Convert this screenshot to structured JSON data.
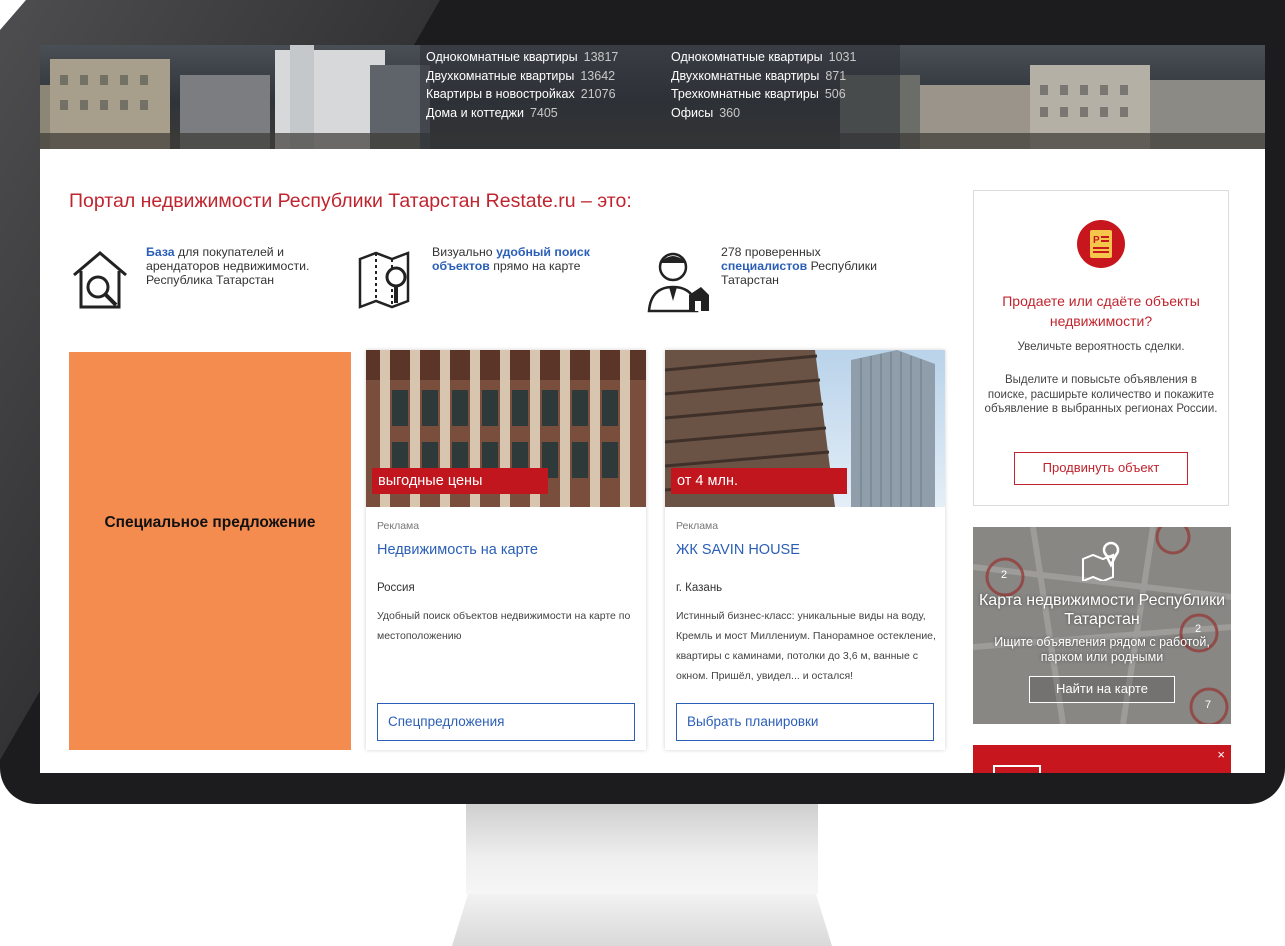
{
  "banner": {
    "stats_left": [
      {
        "label": "Однокомнатные квартиры",
        "count": "13817"
      },
      {
        "label": "Двухкомнатные квартиры",
        "count": "13642"
      },
      {
        "label": "Квартиры в новостройках",
        "count": "21076"
      },
      {
        "label": "Дома и коттеджи",
        "count": "7405"
      }
    ],
    "stats_right": [
      {
        "label": "Однокомнатные квартиры",
        "count": "1031"
      },
      {
        "label": "Двухкомнатные квартиры",
        "count": "871"
      },
      {
        "label": "Трехкомнатные квартиры",
        "count": "506"
      },
      {
        "label": "Офисы",
        "count": "360"
      }
    ]
  },
  "intro": {
    "title": "Портал недвижимости Республики Татарстан Restate.ru – это:",
    "features": [
      {
        "icon": "house-search-icon",
        "bold": "База",
        "text": " для покупателей и арендаторов недвижимости. Республика Татарстан"
      },
      {
        "icon": "map-search-icon",
        "pre": "Визуально ",
        "bold": "удобный поиск объектов",
        "text": " прямо на карте"
      },
      {
        "icon": "specialist-icon",
        "pre": "278 проверенных ",
        "bold": "специалистов",
        "text": " Республики Татарстан"
      }
    ]
  },
  "special_offer": {
    "label": "Специальное предложение",
    "color": "#f48c50"
  },
  "cards": [
    {
      "tag": "выгодные цены",
      "ad_label": "Реклама",
      "title": "Недвижимость на карте",
      "location": "Россия",
      "description": "Удобный поиск объектов недвижимости на карте по местоположению",
      "button": "Спецпредложения"
    },
    {
      "tag": "от 4 млн.",
      "ad_label": "Реклама",
      "title": "ЖК SAVIN HOUSE",
      "location": "г. Казань",
      "description": "Истинный бизнес-класс: уникальные виды на воду, Кремль и мост Миллениум. Панорамное остекление, квартиры с каминами, потолки до 3,6 м, ванные с окном. Пришёл, увидел... и остался!",
      "button": "Выбрать планировки"
    }
  ],
  "promo": {
    "icon": "document-badge-icon",
    "title": "Продаете или сдаёте объекты недвижимости?",
    "line1": "Увеличьте вероятность сделки.",
    "line2": "Выделите и повысьте объявления в поиске, расширьте количество и покажите объявление в выбранных регионах России.",
    "button": "Продвинуть объект"
  },
  "map_card": {
    "icon": "map-pin-icon",
    "title": "Карта недвижимости Республики Татарстан",
    "subtitle": "Ищите объявления рядом с работой, парком или родными",
    "button": "Найти на карте",
    "map_labels": [
      "2",
      "2",
      "7"
    ]
  },
  "red_banner": {
    "close": "×"
  },
  "colors": {
    "accent_red": "#c0242e",
    "link_blue": "#2b5fb7",
    "tag_red": "#c2161e"
  }
}
